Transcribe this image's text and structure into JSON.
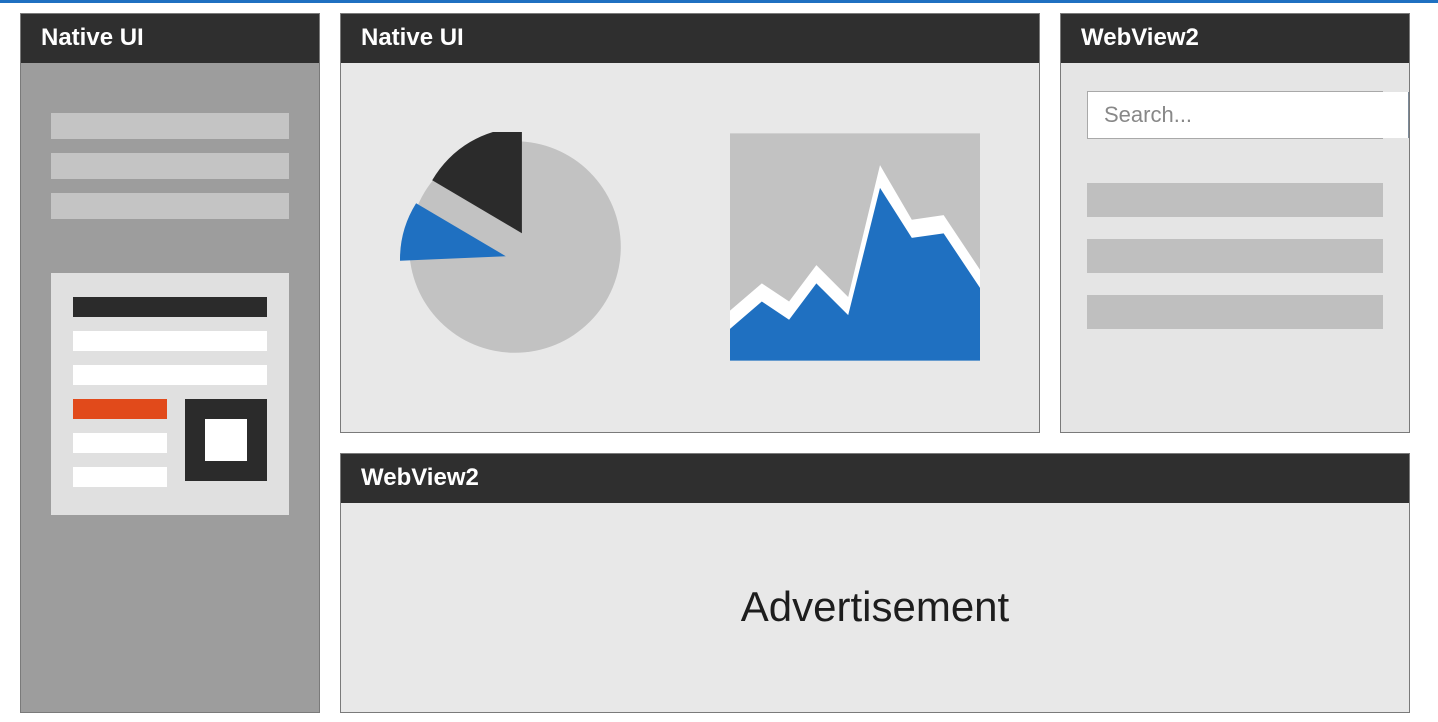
{
  "colors": {
    "header_bg": "#2f2f2f",
    "accent_blue": "#1f70c1",
    "accent_orange": "#e14a1b",
    "panel_light": "#e8e8e8",
    "panel_grey": "#9d9d9d"
  },
  "left": {
    "title": "Native UI",
    "top_bars": 3,
    "card": {
      "has_title_bar": true,
      "white_lines": 2,
      "bottom_lines": [
        "orange",
        "white",
        "white"
      ],
      "has_square_glyph": true
    }
  },
  "center_top": {
    "title": "Native UI",
    "icons": [
      "pie-chart-icon",
      "area-chart-icon"
    ]
  },
  "right": {
    "title": "WebView2",
    "search": {
      "placeholder": "Search..."
    },
    "result_bars": 3
  },
  "bottom": {
    "title": "WebView2",
    "content": "Advertisement"
  }
}
